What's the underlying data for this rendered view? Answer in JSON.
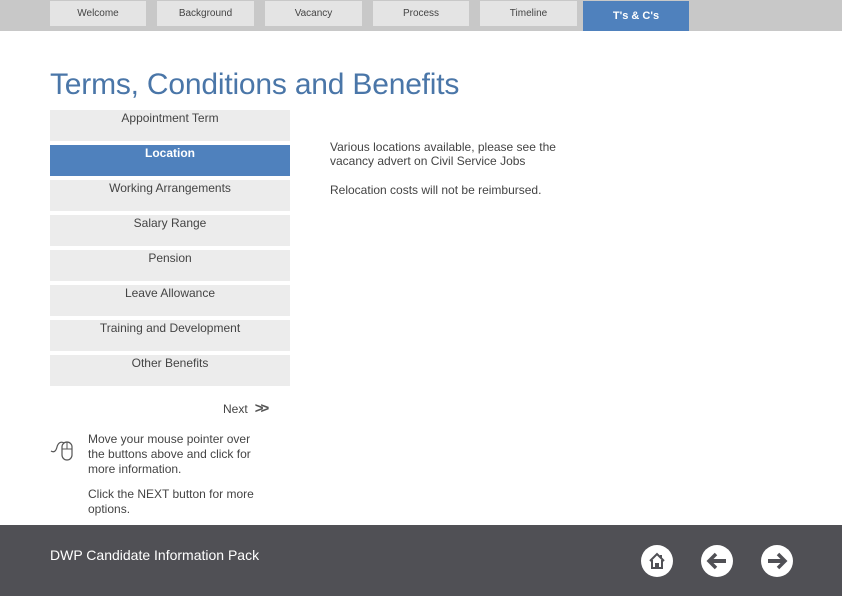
{
  "nav": {
    "tabs": [
      {
        "label": "Welcome",
        "active": false
      },
      {
        "label": "Background",
        "active": false
      },
      {
        "label": "Vacancy",
        "active": false
      },
      {
        "label": "Process",
        "active": false
      },
      {
        "label": "Timeline",
        "active": false
      },
      {
        "label": "T's & C's",
        "active": true
      }
    ]
  },
  "page": {
    "title": "Terms, Conditions and Benefits"
  },
  "menu": {
    "items": [
      {
        "label": "Appointment Term",
        "active": false
      },
      {
        "label": "Location",
        "active": true
      },
      {
        "label": "Working Arrangements",
        "active": false
      },
      {
        "label": "Salary Range",
        "active": false
      },
      {
        "label": "Pension",
        "active": false
      },
      {
        "label": "Leave Allowance",
        "active": false
      },
      {
        "label": "Training and Development",
        "active": false
      },
      {
        "label": "Other Benefits",
        "active": false
      }
    ]
  },
  "detail": {
    "paragraphs": [
      "Various locations available, please see the vacancy advert on Civil Service Jobs",
      "Relocation costs will not be reimbursed."
    ]
  },
  "next": {
    "label": "Next",
    "icon": "double-chevron-right-icon",
    "glyph": ">>"
  },
  "hint": {
    "icon": "mouse-icon",
    "instruction": "Move your mouse pointer over the buttons above and click for more information.",
    "next_instruction": "Click the NEXT button for more options."
  },
  "footer": {
    "title": "DWP Candidate Information Pack",
    "buttons": [
      {
        "name": "home",
        "icon": "home-icon"
      },
      {
        "name": "back",
        "icon": "arrow-left-icon"
      },
      {
        "name": "forward",
        "icon": "arrow-right-icon"
      }
    ]
  },
  "colors": {
    "accent": "#4f81bd",
    "title": "#4a76a8",
    "navbar": "#c8c8c8",
    "tab": "#e4e4e4",
    "menu_item": "#ececec",
    "footer": "#505055"
  }
}
